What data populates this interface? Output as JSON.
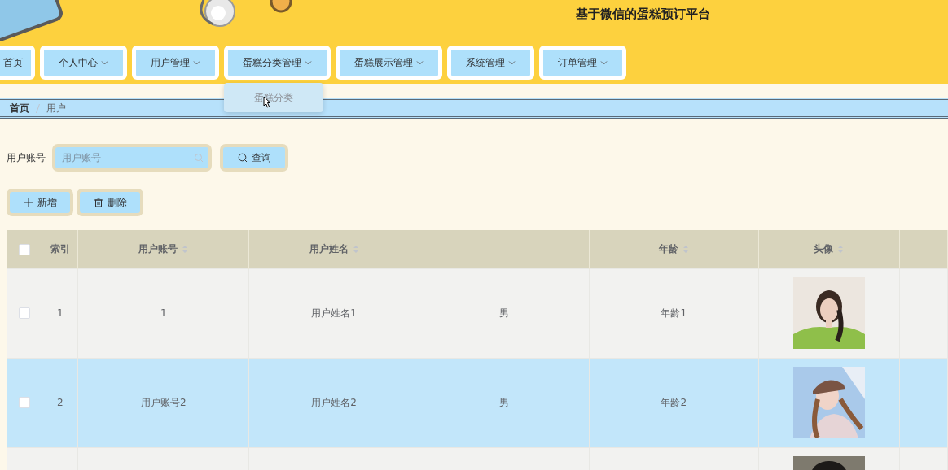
{
  "header": {
    "title": "基于微信的蛋糕预订平台"
  },
  "nav": [
    {
      "label": "首页",
      "has_menu": false
    },
    {
      "label": "个人中心",
      "has_menu": true
    },
    {
      "label": "用户管理",
      "has_menu": true
    },
    {
      "label": "蛋糕分类管理",
      "has_menu": true,
      "submenu": [
        "蛋糕分类"
      ]
    },
    {
      "label": "蛋糕展示管理",
      "has_menu": true
    },
    {
      "label": "系统管理",
      "has_menu": true
    },
    {
      "label": "订单管理",
      "has_menu": true
    }
  ],
  "breadcrumb": [
    "首页",
    "用户"
  ],
  "search": {
    "label": "用户账号",
    "placeholder": "用户账号",
    "button": "查询"
  },
  "actions": [
    {
      "kind": "add",
      "label": "新增"
    },
    {
      "kind": "delete",
      "label": "删除"
    }
  ],
  "table": {
    "columns": [
      {
        "kind": "check",
        "checked": false
      },
      {
        "kind": "text",
        "label": "索引",
        "sortable": false
      },
      {
        "kind": "text",
        "label": "用户账号",
        "sortable": true
      },
      {
        "kind": "text",
        "label": "用户姓名",
        "sortable": true
      },
      {
        "kind": "blank"
      },
      {
        "kind": "text",
        "label": "年龄",
        "sortable": true
      },
      {
        "kind": "text",
        "label": "头像",
        "sortable": true
      },
      {
        "kind": "blank"
      }
    ],
    "rows": [
      {
        "selected": false,
        "checked": false,
        "cells": [
          "1",
          "1",
          "用户姓名1",
          "男",
          "年龄1"
        ]
      },
      {
        "selected": true,
        "checked": false,
        "cells": [
          "2",
          "用户账号2",
          "用户姓名2",
          "男",
          "年龄2"
        ]
      },
      {
        "selected": false
      }
    ]
  }
}
